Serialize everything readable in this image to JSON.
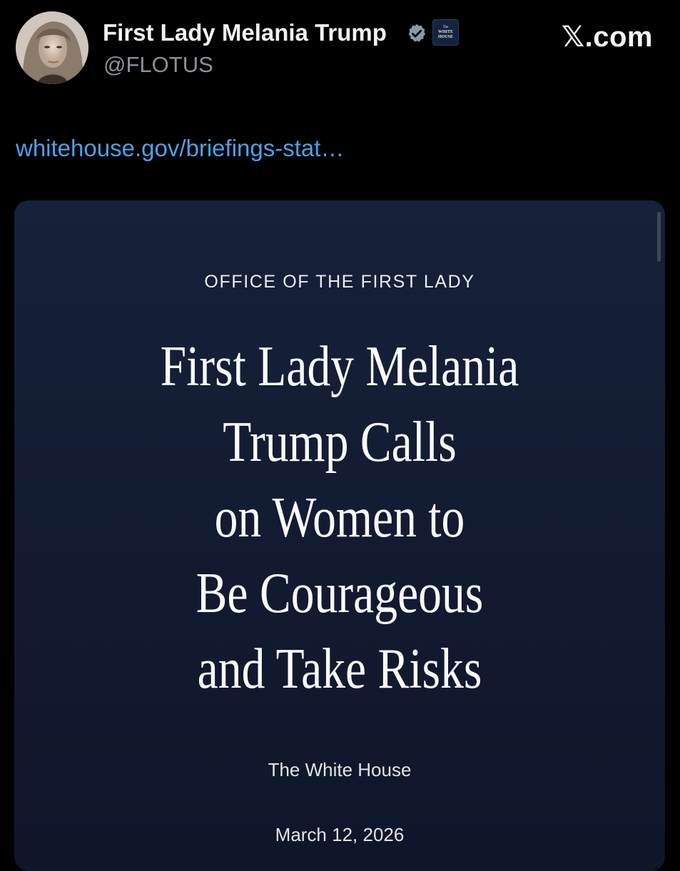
{
  "author": {
    "display_name": "First Lady Melania Trump",
    "handle": "@FLOTUS",
    "avatar_icon": "profile-photo",
    "verified_icon": "verified-badge-icon",
    "affiliate_badge": {
      "line1": "The",
      "line2": "WHITE",
      "line3": "HOUSE"
    }
  },
  "brand": {
    "label": "𝕏.com"
  },
  "tweet": {
    "link_text": "whitehouse.gov/briefings-stat…"
  },
  "card": {
    "kicker": "OFFICE OF THE FIRST LADY",
    "headline_lines": [
      "First Lady Melania",
      "Trump Calls",
      "on Women to",
      "Be Courageous",
      "and Take Risks"
    ],
    "source": "The White House",
    "date": "March 12, 2026"
  },
  "colors": {
    "background": "#000000",
    "link": "#4da1e6",
    "card_background": "#16213a",
    "verified": "#8b98a5"
  }
}
